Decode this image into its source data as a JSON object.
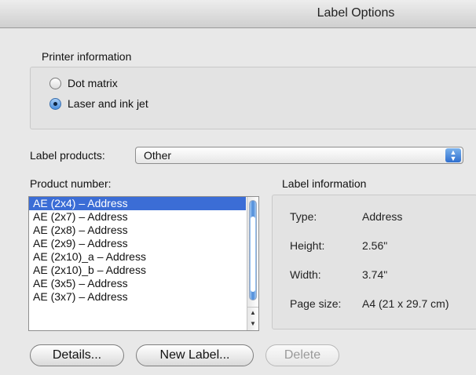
{
  "window": {
    "title": "Label Options"
  },
  "printer": {
    "label": "Printer information",
    "options": [
      {
        "label": "Dot matrix",
        "selected": false
      },
      {
        "label": "Laser and ink jet",
        "selected": true
      }
    ]
  },
  "label_products": {
    "label": "Label products:",
    "value": "Other"
  },
  "product_number": {
    "label": "Product number:",
    "items": [
      "AE (2x4) – Address",
      "AE (2x7) – Address",
      "AE (2x8) – Address",
      "AE (2x9) – Address",
      "AE (2x10)_a – Address",
      "AE (2x10)_b – Address",
      "AE (3x5) – Address",
      "AE (3x7) – Address"
    ],
    "selected_index": 0
  },
  "label_info": {
    "label": "Label information",
    "rows": [
      {
        "key": "Type:",
        "value": "Address"
      },
      {
        "key": "Height:",
        "value": "2.56\""
      },
      {
        "key": "Width:",
        "value": "3.74\""
      },
      {
        "key": "Page size:",
        "value": "A4 (21 x 29.7 cm)"
      }
    ]
  },
  "buttons": {
    "details": "Details...",
    "new_label": "New Label...",
    "delete": "Delete"
  },
  "colors": {
    "selection": "#3b6dd6",
    "accent": "#4a8fe0"
  }
}
